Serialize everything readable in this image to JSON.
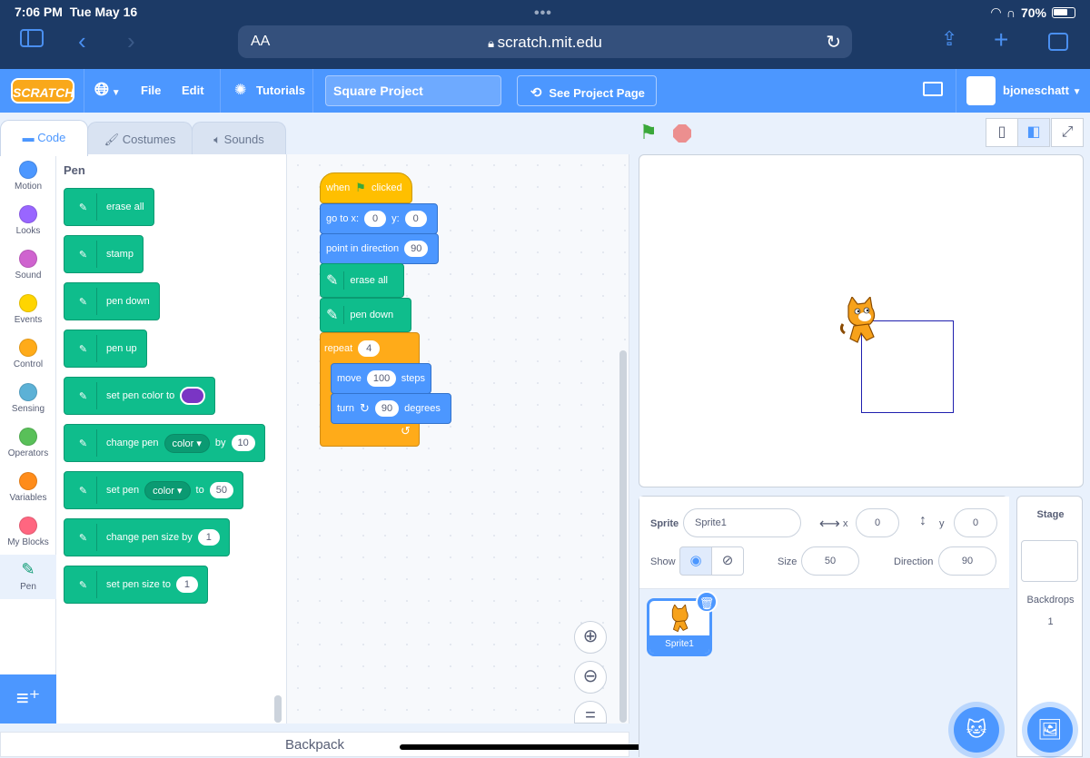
{
  "status_bar": {
    "time": "7:06 PM",
    "date": "Tue May 16",
    "battery": "70%"
  },
  "browser": {
    "aa": "AA",
    "url": "scratch.mit.edu"
  },
  "menu": {
    "logo": "SCRATCH",
    "file": "File",
    "edit": "Edit",
    "tutorials": "Tutorials",
    "project_title": "Square Project",
    "see_project": "See Project Page",
    "username": "bjoneschatt"
  },
  "tabs": {
    "code": "Code",
    "costumes": "Costumes",
    "sounds": "Sounds"
  },
  "categories": [
    {
      "label": "Motion",
      "color": "#4c97ff"
    },
    {
      "label": "Looks",
      "color": "#9966ff"
    },
    {
      "label": "Sound",
      "color": "#cf63cf"
    },
    {
      "label": "Events",
      "color": "#ffd500"
    },
    {
      "label": "Control",
      "color": "#ffab19"
    },
    {
      "label": "Sensing",
      "color": "#5cb1d6"
    },
    {
      "label": "Operators",
      "color": "#59c059"
    },
    {
      "label": "Variables",
      "color": "#ff8c1a"
    },
    {
      "label": "My Blocks",
      "color": "#ff6680"
    },
    {
      "label": "Pen",
      "color": ""
    }
  ],
  "palette": {
    "heading": "Pen",
    "erase_all": "erase all",
    "stamp": "stamp",
    "pen_down": "pen down",
    "pen_up": "pen up",
    "set_pen_color_to": "set pen color to",
    "change_pen": "change pen",
    "color_dd": "color",
    "by": "by",
    "change_by_value": "10",
    "set_pen": "set pen",
    "to": "to",
    "set_to_value": "50",
    "change_pen_size_by": "change pen size by",
    "size_by_value": "1",
    "set_pen_size_to": "set pen size to",
    "size_to_value": "1"
  },
  "script": {
    "when": "when",
    "clicked": "clicked",
    "goto": "go to x:",
    "goto_x": "0",
    "y_label": "y:",
    "goto_y": "0",
    "point_dir": "point in direction",
    "point_value": "90",
    "erase_all": "erase all",
    "pen_down": "pen down",
    "repeat": "repeat",
    "repeat_value": "4",
    "move": "move",
    "move_value": "100",
    "steps": "steps",
    "turn": "turn",
    "turn_value": "90",
    "degrees": "degrees"
  },
  "zoom": {
    "reset": "="
  },
  "backpack": "Backpack",
  "sprite_info": {
    "sprite_label": "Sprite",
    "sprite_name": "Sprite1",
    "x_label": "x",
    "x_value": "0",
    "y_label": "y",
    "y_value": "0",
    "show_label": "Show",
    "size_label": "Size",
    "size_value": "50",
    "direction_label": "Direction",
    "direction_value": "90"
  },
  "sprite_list": [
    {
      "name": "Sprite1"
    }
  ],
  "stage_pane": {
    "title": "Stage",
    "backdrops_label": "Backdrops",
    "backdrops_count": "1"
  }
}
